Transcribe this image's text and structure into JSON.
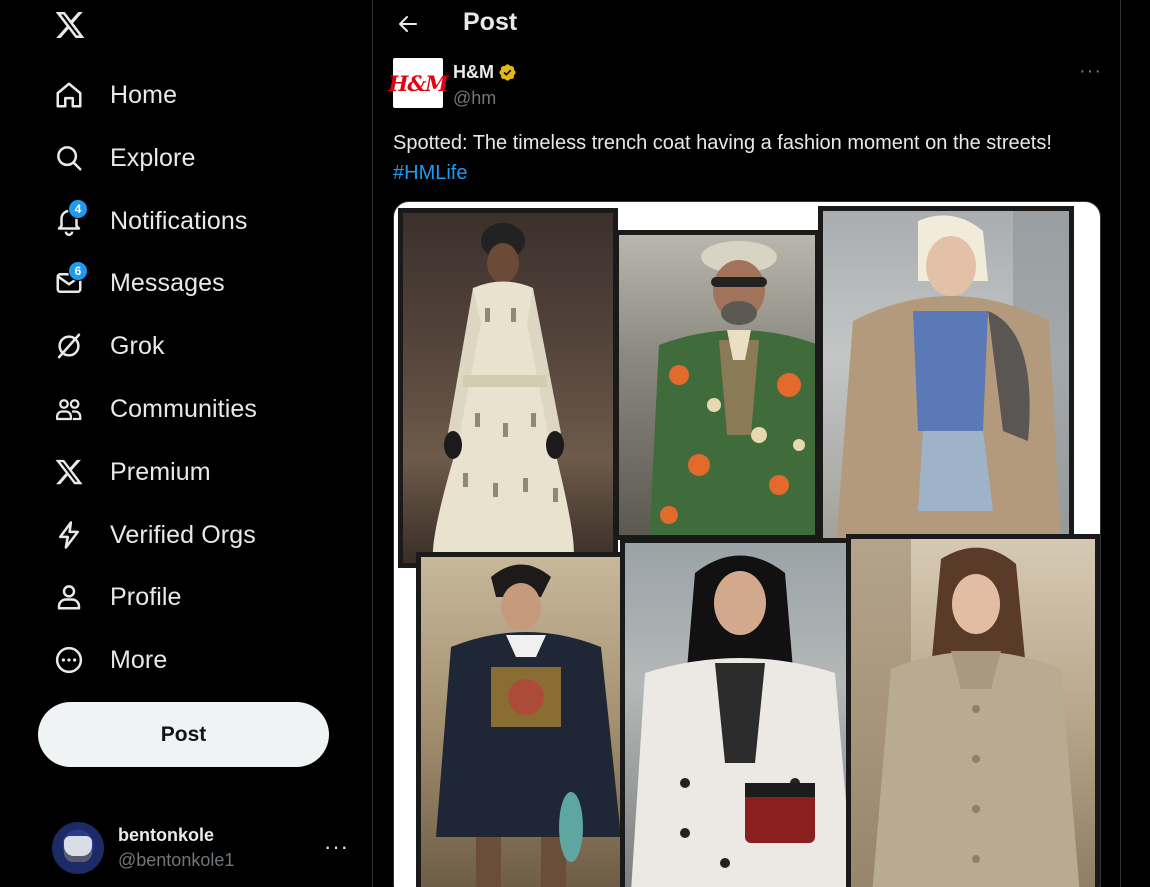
{
  "sidebar": {
    "logo_icon": "x-logo-icon",
    "items": [
      {
        "label": "Home",
        "icon": "home-icon"
      },
      {
        "label": "Explore",
        "icon": "search-icon"
      },
      {
        "label": "Notifications",
        "icon": "bell-icon",
        "badge": "4"
      },
      {
        "label": "Messages",
        "icon": "envelope-icon",
        "badge": "6"
      },
      {
        "label": "Grok",
        "icon": "grok-icon"
      },
      {
        "label": "Communities",
        "icon": "communities-icon"
      },
      {
        "label": "Premium",
        "icon": "x-logo-icon"
      },
      {
        "label": "Verified Orgs",
        "icon": "lightning-icon"
      },
      {
        "label": "Profile",
        "icon": "person-icon"
      },
      {
        "label": "More",
        "icon": "more-circle-icon"
      }
    ],
    "post_button": "Post",
    "account": {
      "name": "bentonkole",
      "handle": "@bentonkole1",
      "more": "···"
    }
  },
  "header": {
    "title": "Post",
    "back_icon": "arrow-left-icon"
  },
  "post": {
    "author_logo": "H&M",
    "author_name": "H&M",
    "author_handle": "@hm",
    "verified_color": "#e2b719",
    "more": "···",
    "text": "Spotted: The timeless trench coat having a fashion moment on the streets! ",
    "hashtag": "#HMLife"
  },
  "colors": {
    "background": "#000000",
    "text": "#e7e9ea",
    "muted": "#71767b",
    "accent": "#1d9bf0",
    "border": "#2f3336"
  }
}
